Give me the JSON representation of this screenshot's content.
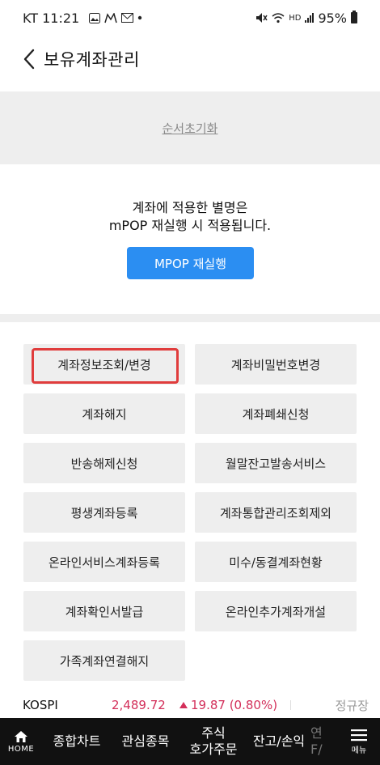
{
  "status_bar": {
    "carrier_time": "KT 11:21",
    "network_label": "HD",
    "battery": "95%"
  },
  "header": {
    "title": "보유계좌관리"
  },
  "reset": {
    "label": "순서초기화"
  },
  "notice": {
    "line1": "계좌에 적용한 별명은",
    "line2": "mPOP 재실행 시 적용됩니다."
  },
  "restart_button": {
    "label": "MPOP 재실행",
    "color": "#2b8ef2"
  },
  "menu": {
    "items": [
      {
        "label": "계좌정보조회/변경",
        "selected": true
      },
      {
        "label": "계좌비밀번호변경"
      },
      {
        "label": "계좌해지"
      },
      {
        "label": "계좌폐쇄신청"
      },
      {
        "label": "반송해제신청"
      },
      {
        "label": "월말잔고발송서비스"
      },
      {
        "label": "평생계좌등록"
      },
      {
        "label": "계좌통합관리조회제외"
      },
      {
        "label": "온라인서비스계좌등록"
      },
      {
        "label": "미수/동결계좌현황"
      },
      {
        "label": "계좌확인서발급"
      },
      {
        "label": "온라인추가계좌개설"
      },
      {
        "label": "가족계좌연결해지"
      }
    ]
  },
  "ticker": {
    "name": "KOSPI",
    "value": "2,489.72",
    "change": "19.87 (0.80%)",
    "status": "정규장",
    "up_color": "#d32f5a"
  },
  "bottom_nav": {
    "home": "HOME",
    "items": [
      "종합차트",
      "관심종목",
      "주식\n호가주문",
      "잔고/손익",
      "연\nF/"
    ],
    "menu": "메뉴"
  }
}
